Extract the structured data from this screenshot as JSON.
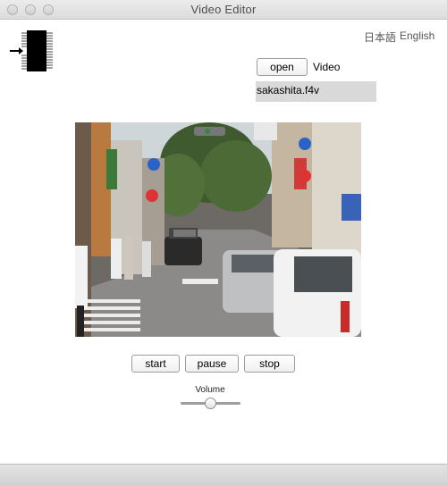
{
  "window": {
    "title": "Video Editor"
  },
  "language": {
    "japanese": "日本語",
    "english": "English"
  },
  "file": {
    "open_label": "open",
    "type_label": "Video",
    "filename": "sakashita.f4v"
  },
  "controls": {
    "start_label": "start",
    "pause_label": "pause",
    "stop_label": "stop"
  },
  "volume": {
    "label": "Volume",
    "level": 0.5
  },
  "icons": {
    "logo": "chip-icon"
  }
}
